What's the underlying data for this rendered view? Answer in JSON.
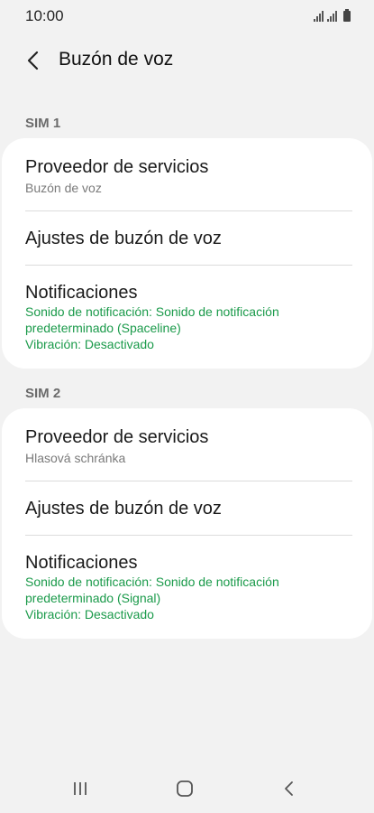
{
  "status_bar": {
    "time": "10:00",
    "icons": [
      "signal-icon",
      "signal-icon",
      "battery-icon"
    ]
  },
  "header": {
    "back_icon": "chevron-left-icon",
    "title": "Buzón de voz"
  },
  "sim1": {
    "label": "SIM 1",
    "items": [
      {
        "title": "Proveedor de servicios",
        "subtitle": "Buzón de voz"
      },
      {
        "title": "Ajustes de buzón de voz"
      },
      {
        "title": "Notificaciones",
        "line1": "Sonido de notificación: Sonido de notificación",
        "line2": "predeterminado (Spaceline)",
        "line3": "Vibración: Desactivado"
      }
    ]
  },
  "sim2": {
    "label": "SIM 2",
    "items": [
      {
        "title": "Proveedor de servicios",
        "subtitle": "Hlasová schránka"
      },
      {
        "title": "Ajustes de buzón de voz"
      },
      {
        "title": "Notificaciones",
        "line1": "Sonido de notificación: Sonido de notificación",
        "line2": "predeterminado (Signal)",
        "line3": "Vibración: Desactivado"
      }
    ]
  },
  "nav_bar": {
    "buttons": [
      "recent-apps-icon",
      "home-icon",
      "back-icon"
    ]
  },
  "colors": {
    "background": "#f2f2f2",
    "card": "#ffffff",
    "accent_green": "#1a9a4a",
    "section_label": "#6b6b6b"
  }
}
